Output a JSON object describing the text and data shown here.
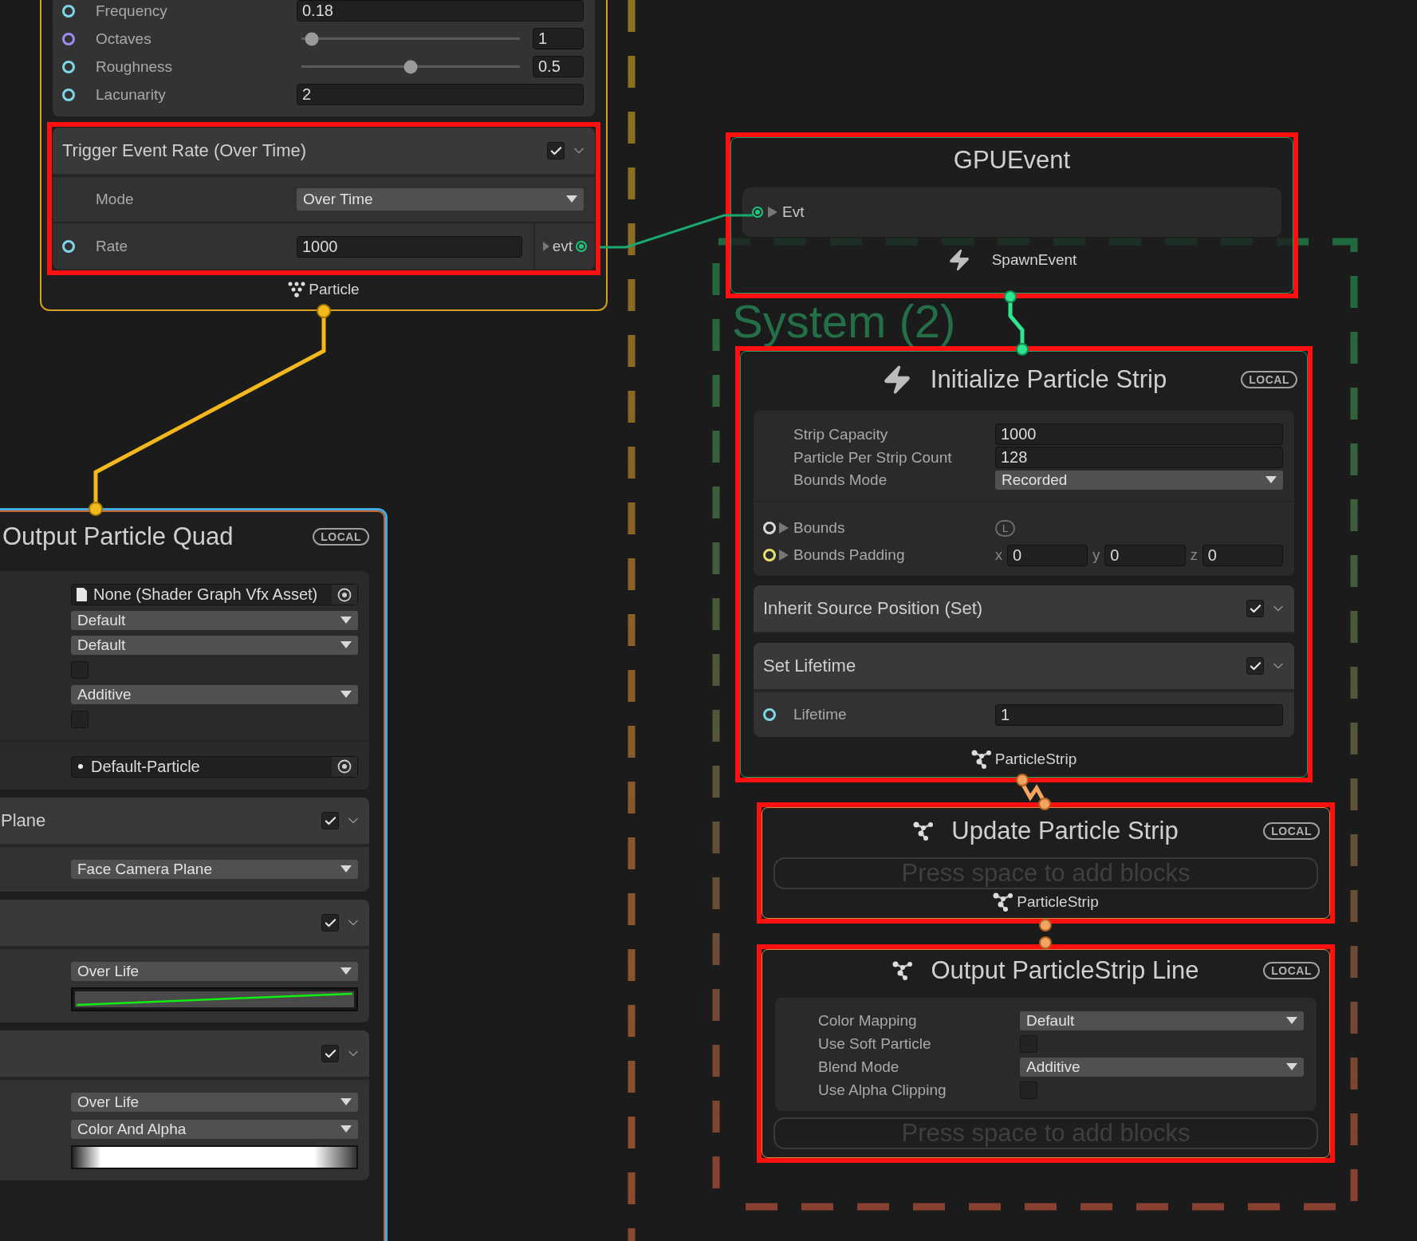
{
  "system_label": "System (2)",
  "spawn_context": {
    "settings": [
      {
        "label": "Frequency",
        "kind": "field",
        "value": "0.18",
        "color": "#7fd6e8"
      },
      {
        "label": "Octaves",
        "kind": "slider",
        "level": 0.02,
        "value": "1",
        "color": "#a08cf0"
      },
      {
        "label": "Roughness",
        "kind": "slider",
        "level": 0.5,
        "value": "0.5",
        "color": "#7fd6e8"
      },
      {
        "label": "Lacunarity",
        "kind": "field",
        "value": "2",
        "color": "#7fd6e8"
      }
    ],
    "trigger_block": {
      "title": "Trigger Event Rate (Over Time)",
      "checked": true,
      "highlighted": true,
      "mode": {
        "label": "Mode",
        "value": "Over Time"
      },
      "rate": {
        "label": "Rate",
        "value": "1000",
        "color": "#7fd6e8"
      },
      "output": "evt"
    },
    "footer": "Particle"
  },
  "gpu_event": {
    "title": "GPUEvent",
    "highlighted": true,
    "input": "Evt",
    "footer": "SpawnEvent"
  },
  "initialize": {
    "title": "Initialize Particle Strip",
    "badge": "LOCAL",
    "highlighted": true,
    "settings": [
      {
        "label": "Strip Capacity",
        "kind": "field",
        "value": "1000"
      },
      {
        "label": "Particle Per Strip Count",
        "kind": "field",
        "value": "128"
      },
      {
        "label": "Bounds Mode",
        "kind": "dropdown",
        "value": "Recorded"
      }
    ],
    "properties": [
      {
        "label": "Bounds",
        "kind": "space",
        "badge": "L",
        "color": "#d8d8d8",
        "expanded": false
      },
      {
        "label": "Bounds Padding",
        "kind": "vector",
        "color": "#e8e070",
        "expanded": false,
        "components": [
          {
            "axis": "x",
            "value": "0"
          },
          {
            "axis": "y",
            "value": "0"
          },
          {
            "axis": "z",
            "value": "0"
          }
        ]
      }
    ],
    "blocks": [
      {
        "title": "Inherit Source Position (Set)",
        "checked": true
      },
      {
        "title": "Set Lifetime",
        "checked": true,
        "rows": [
          {
            "label": "Lifetime",
            "kind": "field",
            "value": "1",
            "color": "#7fd6e8"
          }
        ]
      }
    ],
    "footer": "ParticleStrip"
  },
  "update": {
    "title": "Update Particle Strip",
    "badge": "LOCAL",
    "highlighted": true,
    "drop_hint": "Press space to add blocks",
    "footer": "ParticleStrip"
  },
  "output_line": {
    "title": "Output ParticleStrip Line",
    "badge": "LOCAL",
    "highlighted": true,
    "settings": [
      {
        "label": "Color Mapping",
        "kind": "dropdown",
        "value": "Default"
      },
      {
        "label": "Use Soft Particle",
        "kind": "checkbox",
        "checked": false
      },
      {
        "label": "Blend Mode",
        "kind": "dropdown",
        "value": "Additive"
      },
      {
        "label": "Use Alpha Clipping",
        "kind": "checkbox",
        "checked": false
      }
    ],
    "drop_hint": "Press space to add blocks"
  },
  "output_quad": {
    "title": "Output Particle Quad",
    "badge": "LOCAL",
    "settings": [
      {
        "kind": "shader-object",
        "value": "None (Shader Graph Vfx Asset)"
      },
      {
        "kind": "dropdown",
        "value": "Default"
      },
      {
        "kind": "dropdown",
        "value": "Default"
      },
      {
        "kind": "checkbox",
        "checked": false
      },
      {
        "kind": "dropdown",
        "value": "Additive"
      },
      {
        "kind": "checkbox",
        "checked": false
      }
    ],
    "texture": {
      "kind": "texture-object",
      "value": "Default-Particle"
    },
    "blocks": [
      {
        "title": "Plane",
        "checked": true,
        "rows": [
          {
            "kind": "dropdown",
            "value": "Face Camera Plane"
          }
        ]
      },
      {
        "checked": true,
        "rows": [
          {
            "kind": "dropdown",
            "value": "Over Life"
          },
          {
            "kind": "curve"
          }
        ]
      },
      {
        "checked": true,
        "rows": [
          {
            "kind": "dropdown",
            "value": "Over Life"
          },
          {
            "kind": "dropdown",
            "value": "Color And Alpha"
          },
          {
            "kind": "gradient"
          }
        ]
      }
    ]
  }
}
